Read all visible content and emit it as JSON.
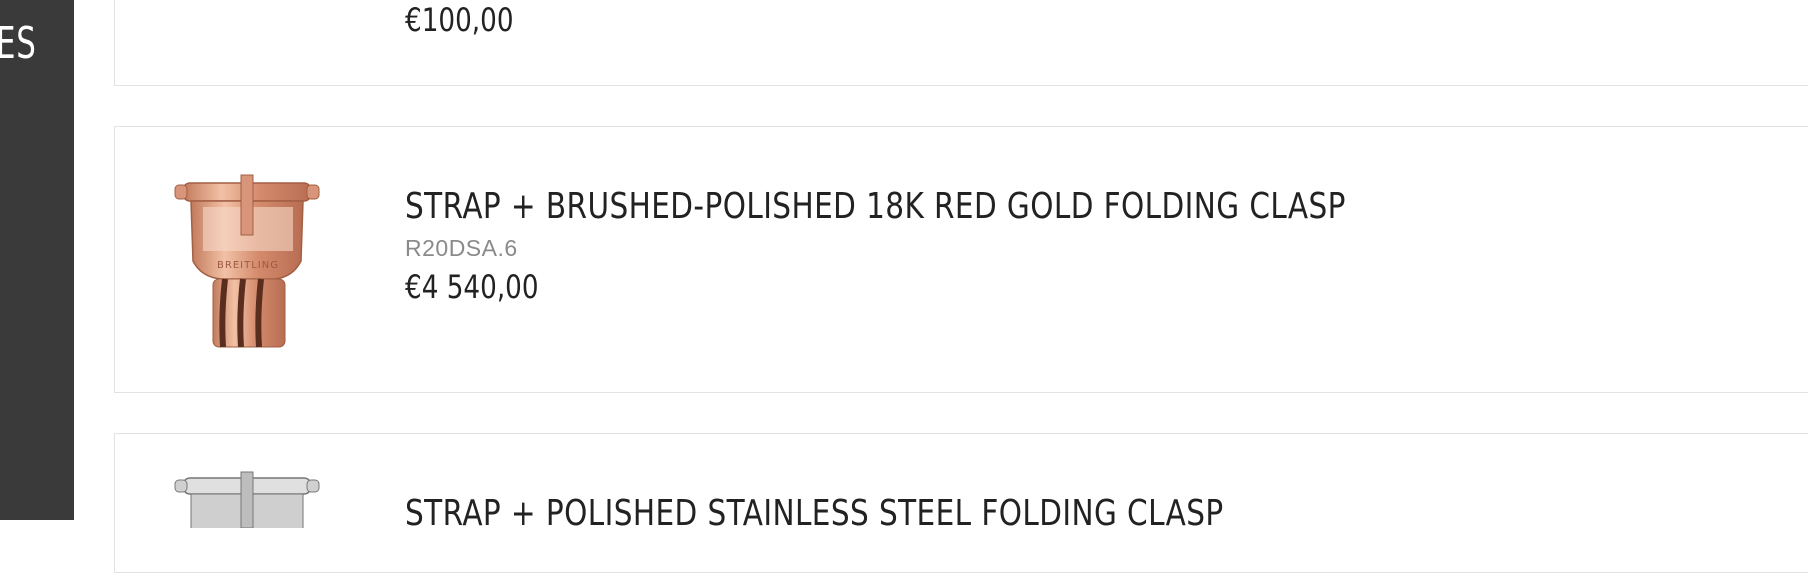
{
  "sidebar": {
    "label": "ES"
  },
  "products": [
    {
      "price": "€100,00"
    },
    {
      "title": "STRAP + BRUSHED-POLISHED 18K RED GOLD FOLDING CLASP",
      "ref": "R20DSA.6",
      "price": "€4 540,00",
      "brand_mark": "BREITLING"
    },
    {
      "title": "STRAP + POLISHED STAINLESS STEEL FOLDING CLASP"
    }
  ],
  "colors": {
    "sidebar": "#3a3a3a",
    "gold": "#d9957a",
    "steel": "#c8c8c8"
  }
}
